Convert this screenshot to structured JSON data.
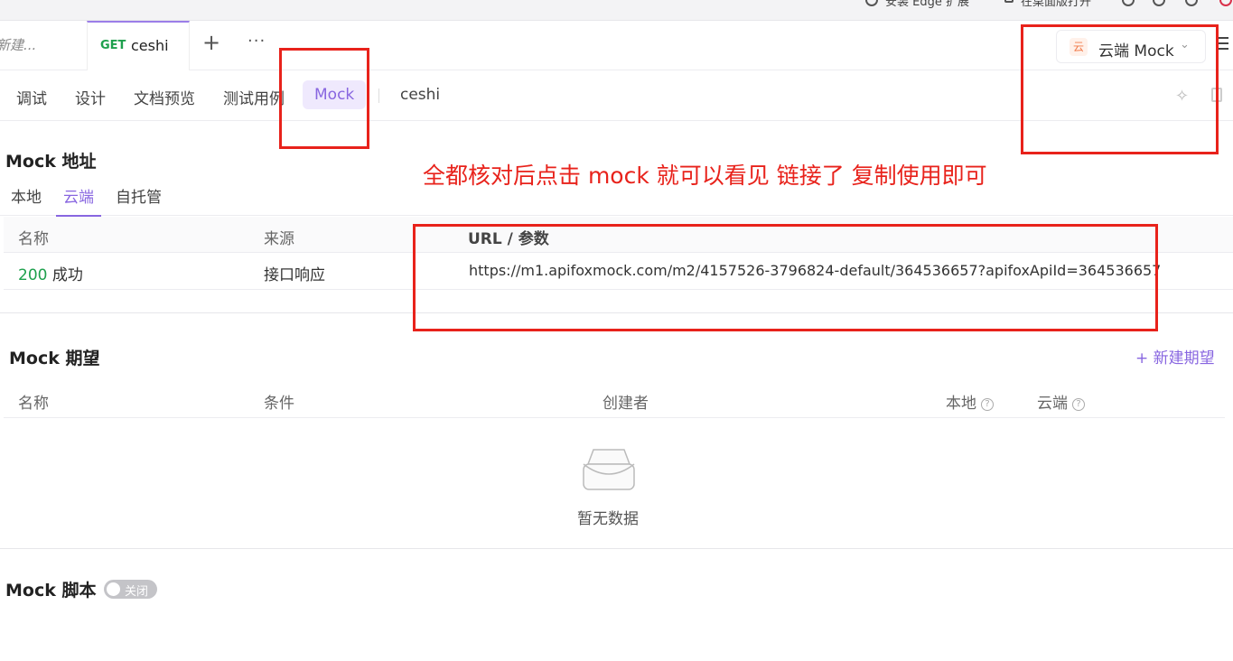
{
  "browser_strip": {
    "edge_ext": "安装 Edge 扩展",
    "desktop_open": "在桌面版打开"
  },
  "tabs": {
    "prev_tab": "新建...",
    "active_method": "GET",
    "active_name": "ceshi"
  },
  "env": {
    "badge": "云",
    "label": "云端 Mock"
  },
  "subtabs": [
    "调试",
    "设计",
    "文档预览",
    "测试用例",
    "Mock"
  ],
  "subtab_path": "ceshi",
  "mock_address": {
    "title": "Mock 地址",
    "env_tabs": [
      "本地",
      "云端",
      "自托管"
    ],
    "columns": [
      "名称",
      "来源",
      "URL / 参数"
    ],
    "row": {
      "code": "200",
      "status": "成功",
      "source": "接口响应",
      "url": "https://m1.apifoxmock.com/m2/4157526-3796824-default/364536657?apifoxApiId=364536657"
    }
  },
  "expectations": {
    "title": "Mock 期望",
    "new_label": "+ 新建期望",
    "columns": [
      "名称",
      "条件",
      "创建者",
      "本地",
      "云端"
    ],
    "empty": "暂无数据"
  },
  "script": {
    "title": "Mock 脚本",
    "toggle": "关闭"
  },
  "annotation": "全都核对后点击 mock  就可以看见 链接了  复制使用即可",
  "colors": {
    "accent": "#8866e0",
    "success": "#1ea04d",
    "annotation": "#e8221b"
  }
}
